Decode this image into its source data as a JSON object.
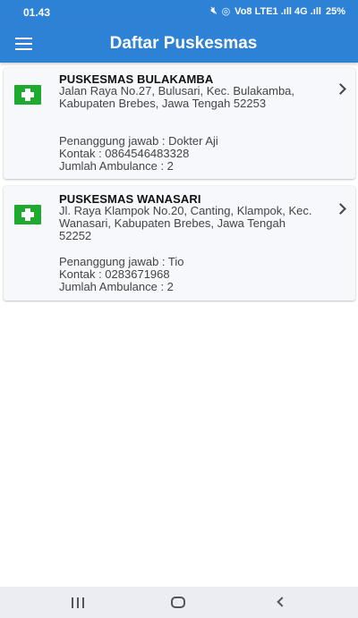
{
  "status_bar": {
    "time": "01.43",
    "network_label": "Vo8 LTE1 .ıll 4G .ıll",
    "battery": "25%"
  },
  "app_bar": {
    "title": "Daftar Puskesmas",
    "menu_icon": "hamburger-menu-icon"
  },
  "puskesmas": [
    {
      "name": "PUSKESMAS BULAKAMBA",
      "address": "Jalan Raya No.27, Bulusari, Kec. Bulakamba, Kabupaten Brebes, Jawa Tengah 52253",
      "penanggung_jawab": "Penanggung jawab : Dokter Aji",
      "kontak": "Kontak : 0864546483328",
      "ambulance": "Jumlah Ambulance : 2"
    },
    {
      "name": "PUSKESMAS WANASARI",
      "address": "Jl. Raya Klampok No.20, Canting, Klampok, Kec. Wanasari, Kabupaten Brebes, Jawa Tengah 52252",
      "penanggung_jawab": "Penanggung jawab : Tio",
      "kontak": "Kontak : 0283671968",
      "ambulance": "Jumlah Ambulance : 2"
    }
  ],
  "colors": {
    "primary": "#2e82d6",
    "hospital_icon": "#1eaa2e",
    "card_bg": "#f6f8fb",
    "nav_bg": "#ecedf2"
  },
  "nav_bar": {
    "recent_icon": "recent-apps-icon",
    "home_icon": "home-icon",
    "back_icon": "back-icon"
  }
}
